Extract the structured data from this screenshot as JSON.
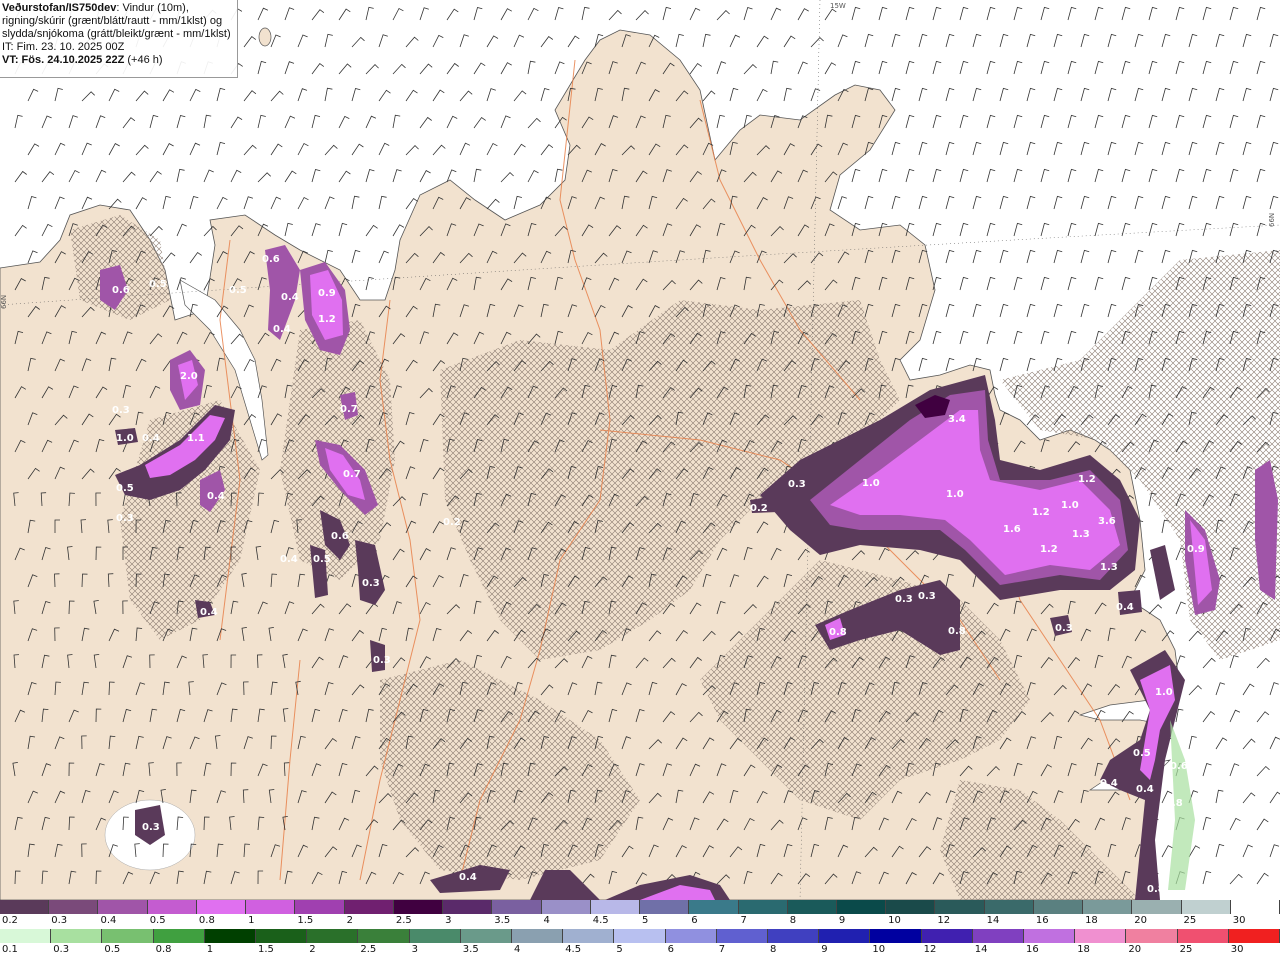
{
  "title": {
    "source": "Veðurstofan/IS750dev",
    "desc1": ": Vindur (10m),",
    "desc2": "rigning/skúrir (grænt/blátt/rautt - mm/1klst) og",
    "desc3": "slydda/snjókoma (grátt/bleikt/grænt - mm/1klst)",
    "it": "IT: Fim. 23. 10. 2025 00Z",
    "vt": "VT: Fös. 24.10.2025 22Z",
    "vt_offset": "(+46 h)"
  },
  "grid_labels": {
    "lon": "15W",
    "lat_left": "66N",
    "lat_right": "66N"
  },
  "colors": {
    "land": "#f2e2cf",
    "sea": "#ffffff",
    "roads": "#e8804a",
    "wind": "#333333"
  },
  "legend_snow": {
    "labels": [
      "0.2",
      "0.3",
      "0.4",
      "0.5",
      "0.8",
      "1",
      "1.5",
      "2",
      "2.5",
      "3",
      "3.5",
      "4",
      "4.5",
      "5",
      "6",
      "7",
      "8",
      "9",
      "10",
      "12",
      "14",
      "16",
      "18",
      "20",
      "25",
      "30"
    ],
    "colors": [
      "#5a3a5a",
      "#7a4a7a",
      "#a055a8",
      "#c45cd0",
      "#e070f0",
      "#d060e0",
      "#a040b0",
      "#702070",
      "#400040",
      "#5a2a6a",
      "#7a60a0",
      "#9a90c8",
      "#b8b8e8",
      "#7070a8",
      "#3a7a8a",
      "#2a6a70",
      "#1a5a5a",
      "#0a4a4a",
      "#1a4a4a",
      "#2a5a5a",
      "#3a6a6a",
      "#5a8080",
      "#7a9a9a",
      "#9ab0b0",
      "#c0d0d0",
      "#ffffff"
    ]
  },
  "legend_rain": {
    "labels": [
      "0.1",
      "0.3",
      "0.5",
      "0.8",
      "1",
      "1.5",
      "2",
      "2.5",
      "3",
      "3.5",
      "4",
      "4.5",
      "5",
      "6",
      "7",
      "8",
      "9",
      "10",
      "12",
      "14",
      "16",
      "18",
      "20",
      "25",
      "30"
    ],
    "colors": [
      "#d8f8d8",
      "#a8e0a0",
      "#78c070",
      "#40a040",
      "#004000",
      "#1a601a",
      "#2a702a",
      "#3a803a",
      "#4a8a6a",
      "#6a9a8a",
      "#8aa0b0",
      "#a0b0d0",
      "#b8c0f0",
      "#9090e0",
      "#6060d0",
      "#4040c0",
      "#2020b0",
      "#0000a0",
      "#4020b0",
      "#8040c0",
      "#c070e0",
      "#f090d0",
      "#f080a0",
      "#f05070",
      "#f02020"
    ]
  },
  "precip_labels": [
    "0.6",
    "0.4",
    "0.4",
    "0.9",
    "1.2",
    "0.7",
    "0.7",
    "0.6",
    "0.5",
    "0.3",
    "0.3",
    "3.4",
    "1.0",
    "1.0",
    "1.6",
    "1.2",
    "1.2",
    "1.0",
    "1.3",
    "3.6",
    "1.3",
    "1.2",
    "0.3",
    "0.3",
    "0.3",
    "0.8",
    "0.8",
    "0.4",
    "0.3",
    "0.9",
    "1.0",
    "0.5",
    "0.4",
    "0.4",
    "0.8",
    "0.3",
    "0.4",
    "2.0",
    "1.1",
    "1.0",
    "0.4",
    "0.6",
    "0.5",
    "0.3",
    "0.4",
    "0.3",
    "0.4",
    "0.4",
    "0.2",
    "0.5",
    "0.5",
    "0.6",
    "0.8",
    "0.2"
  ]
}
